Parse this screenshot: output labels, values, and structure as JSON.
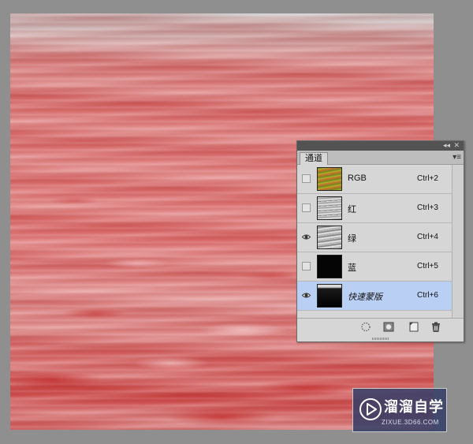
{
  "channels_panel": {
    "tab_label": "通道",
    "titlebar": {
      "collapse_glyph": "◂◂",
      "close_glyph": "✕"
    },
    "menu_glyph": "▾≡",
    "rows": [
      {
        "name": "RGB",
        "shortcut": "Ctrl+2",
        "visible": false,
        "thumbnail": "rgb-composite",
        "selected": false
      },
      {
        "name": "红",
        "shortcut": "Ctrl+3",
        "visible": false,
        "thumbnail": "grayscale-red",
        "selected": false
      },
      {
        "name": "绿",
        "shortcut": "Ctrl+4",
        "visible": true,
        "thumbnail": "grayscale-green",
        "selected": false
      },
      {
        "name": "蓝",
        "shortcut": "Ctrl+5",
        "visible": false,
        "thumbnail": "black",
        "selected": false
      },
      {
        "name": "快速蒙版",
        "shortcut": "Ctrl+6",
        "visible": true,
        "thumbnail": "quick-mask",
        "selected": true
      }
    ],
    "footer_icons": [
      "load-channel-as-selection-icon",
      "save-selection-as-channel-icon",
      "new-channel-icon",
      "delete-channel-icon"
    ]
  },
  "watermark": {
    "title": "溜溜自学",
    "url": "ZIXUE.3D66.COM"
  },
  "colors": {
    "workspace": "#8f8f8f",
    "panel_bg": "#d6d6d6",
    "selected_row": "#b9cff4",
    "canvas_red": "#de7474",
    "watermark_bg": "#343e66"
  }
}
